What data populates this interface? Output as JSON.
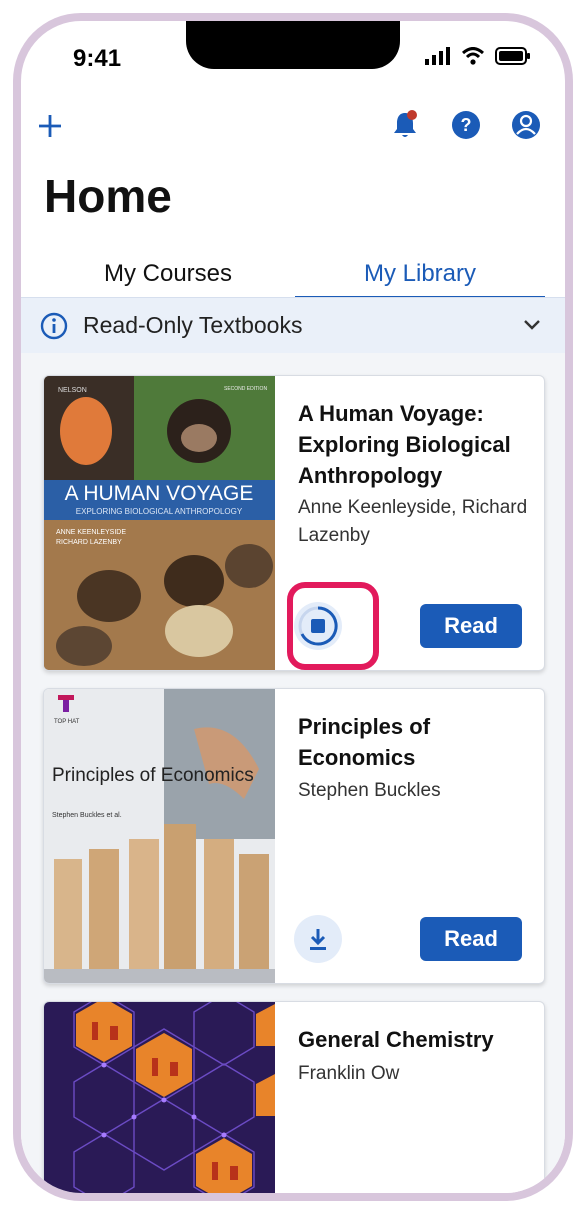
{
  "status_bar": {
    "time": "9:41"
  },
  "header": {
    "title": "Home"
  },
  "tabs": [
    {
      "label": "My Courses",
      "active": false
    },
    {
      "label": "My Library",
      "active": true
    }
  ],
  "banner": {
    "label": "Read-Only Textbooks"
  },
  "books": [
    {
      "title": "A Human Voyage: Exploring Biological Anthropology",
      "author": "Anne Keenleyside, Richard Lazenby",
      "read_label": "Read",
      "status": "downloading",
      "cover": {
        "publisher": "NELSON",
        "edition": "SECOND EDITION",
        "title": "A HUMAN VOYAGE",
        "subtitle": "EXPLORING BIOLOGICAL ANTHROPOLOGY",
        "author1": "ANNE KEENLEYSIDE",
        "author2": "RICHARD LAZENBY"
      }
    },
    {
      "title": "Principles of Economics",
      "author": "Stephen Buckles",
      "read_label": "Read",
      "status": "download",
      "cover": {
        "brand": "TOP HAT",
        "title": "Principles of Economics",
        "author": "Stephen Buckles et al."
      }
    },
    {
      "title": "General Chemistry",
      "author": "Franklin Ow",
      "status": "none"
    }
  ],
  "colors": {
    "accent": "#1b5bb7",
    "highlight": "#e21a5c",
    "notification": "#c0392b"
  }
}
